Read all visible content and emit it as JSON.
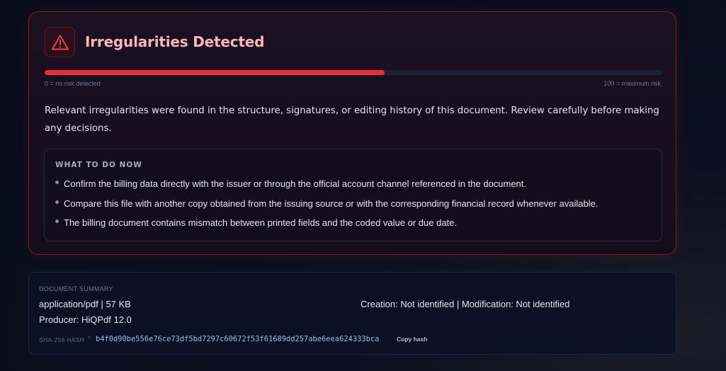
{
  "alert": {
    "title": "Irregularities Detected",
    "risk_score": 55,
    "scale_min_label": "0 = no risk detected",
    "scale_max_label": "100 = maximum risk",
    "description": "Relevant irregularities were found in the structure, signatures, or editing history of this document. Review carefully before making any decisions.",
    "accent_color": "#ee2a3a",
    "icon": "warning-triangle-icon"
  },
  "todo": {
    "title": "WHAT TO DO NOW",
    "items": [
      "Confirm the billing data directly with the issuer or through the official account channel referenced in the document.",
      "Compare this file with another copy obtained from the issuing source or with the corresponding financial record whenever available.",
      "The billing document contains mismatch between printed fields and the coded value or due date."
    ]
  },
  "summary": {
    "title": "DOCUMENT SUMMARY",
    "file_info": "application/pdf | 57 KB",
    "producer": "Producer: HiQPdf 12.0",
    "dates": "Creation: Not identified | Modification: Not identified",
    "hash_label": "SHA-256 HASH",
    "hash_value": "b4f0d90be556e76ce73df5bd7297c60672f53f61689dd257abe6eea624333bca",
    "copy_label": "Copy hash"
  }
}
